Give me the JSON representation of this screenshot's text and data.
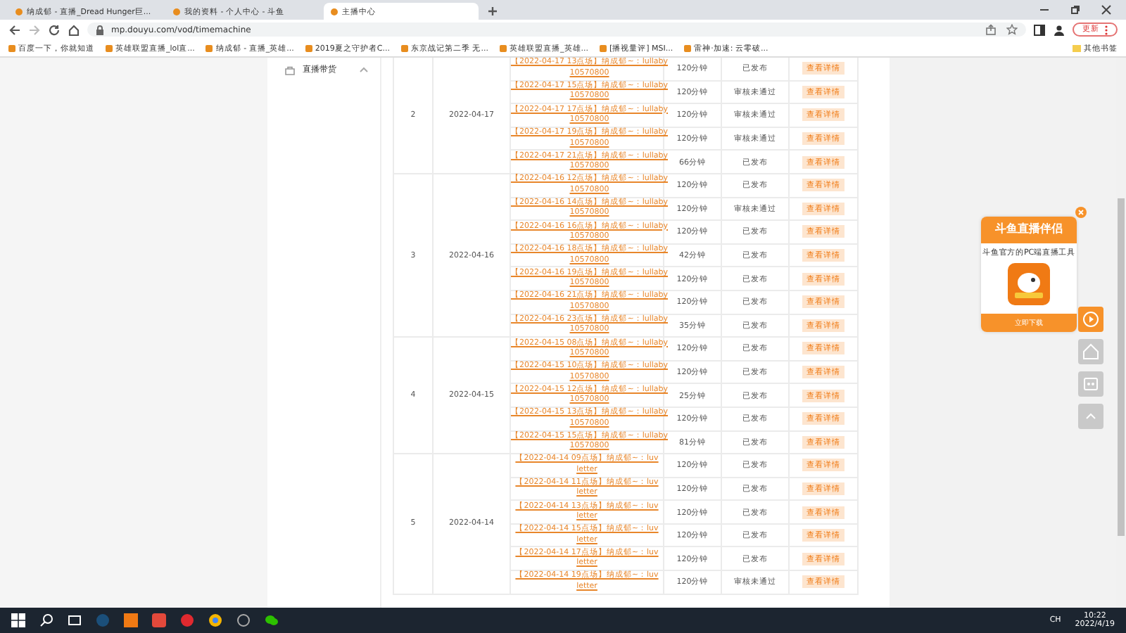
{
  "tabs": [
    {
      "title": "纳成郁 - 直播_Dread Hunger巨...",
      "selected": false
    },
    {
      "title": "我的资料 - 个人中心 - 斗鱼",
      "selected": false
    },
    {
      "title": "主播中心",
      "selected": true
    }
  ],
  "address": "mp.douyu.com/vod/timemachine",
  "update_button": "更新",
  "bookmarks": [
    "百度一下，你就知道",
    "英雄联盟直播_lol直...",
    "纳成郁 - 直播_英雄...",
    "2019夏之守护者C...",
    "东京战记第二季 无...",
    "英雄联盟直播_英雄...",
    "[播视量评] MSI...",
    "雷神·加速: 云零破..."
  ],
  "other_bookmarks": "其他书签",
  "sidebar": {
    "item": "直播带货",
    "expanded": true
  },
  "groups": [
    {
      "index": "2",
      "date": "2022-04-17",
      "rows": [
        {
          "title": [
            "【2022-04-17 13点场】纳成郁~：lullaby",
            "10570800"
          ],
          "duration": "120分钟",
          "status": "已发布",
          "action": "查看详情"
        },
        {
          "title": [
            "【2022-04-17 15点场】纳成郁~：lullaby",
            "10570800"
          ],
          "duration": "120分钟",
          "status": "审核未通过",
          "action": "查看详情"
        },
        {
          "title": [
            "【2022-04-17 17点场】纳成郁~：lullaby",
            "10570800"
          ],
          "duration": "120分钟",
          "status": "审核未通过",
          "action": "查看详情"
        },
        {
          "title": [
            "【2022-04-17 19点场】纳成郁~：lullaby",
            "10570800"
          ],
          "duration": "120分钟",
          "status": "审核未通过",
          "action": "查看详情"
        },
        {
          "title": [
            "【2022-04-17 21点场】纳成郁~：lullaby",
            "10570800"
          ],
          "duration": "66分钟",
          "status": "已发布",
          "action": "查看详情"
        }
      ]
    },
    {
      "index": "3",
      "date": "2022-04-16",
      "rows": [
        {
          "title": [
            "【2022-04-16 12点场】纳成郁~：lullaby",
            "10570800"
          ],
          "duration": "120分钟",
          "status": "已发布",
          "action": "查看详情"
        },
        {
          "title": [
            "【2022-04-16 14点场】纳成郁~：lullaby",
            "10570800"
          ],
          "duration": "120分钟",
          "status": "审核未通过",
          "action": "查看详情"
        },
        {
          "title": [
            "【2022-04-16 16点场】纳成郁~：lullaby",
            "10570800"
          ],
          "duration": "120分钟",
          "status": "已发布",
          "action": "查看详情"
        },
        {
          "title": [
            "【2022-04-16 18点场】纳成郁~：lullaby",
            "10570800"
          ],
          "duration": "42分钟",
          "status": "已发布",
          "action": "查看详情"
        },
        {
          "title": [
            "【2022-04-16 19点场】纳成郁~：lullaby",
            "10570800"
          ],
          "duration": "120分钟",
          "status": "已发布",
          "action": "查看详情"
        },
        {
          "title": [
            "【2022-04-16 21点场】纳成郁~：lullaby",
            "10570800"
          ],
          "duration": "120分钟",
          "status": "已发布",
          "action": "查看详情"
        },
        {
          "title": [
            "【2022-04-16 23点场】纳成郁~：lullaby",
            "10570800"
          ],
          "duration": "35分钟",
          "status": "已发布",
          "action": "查看详情"
        }
      ]
    },
    {
      "index": "4",
      "date": "2022-04-15",
      "rows": [
        {
          "title": [
            "【2022-04-15 08点场】纳成郁~：lullaby",
            "10570800"
          ],
          "duration": "120分钟",
          "status": "已发布",
          "action": "查看详情"
        },
        {
          "title": [
            "【2022-04-15 10点场】纳成郁~：lullaby",
            "10570800"
          ],
          "duration": "120分钟",
          "status": "已发布",
          "action": "查看详情"
        },
        {
          "title": [
            "【2022-04-15 12点场】纳成郁~：lullaby",
            "10570800"
          ],
          "duration": "25分钟",
          "status": "已发布",
          "action": "查看详情"
        },
        {
          "title": [
            "【2022-04-15 13点场】纳成郁~：lullaby",
            "10570800"
          ],
          "duration": "120分钟",
          "status": "已发布",
          "action": "查看详情"
        },
        {
          "title": [
            "【2022-04-15 15点场】纳成郁~：lullaby",
            "10570800"
          ],
          "duration": "81分钟",
          "status": "已发布",
          "action": "查看详情"
        }
      ]
    },
    {
      "index": "5",
      "date": "2022-04-14",
      "rows": [
        {
          "title": [
            "【2022-04-14 09点场】纳成郁~：luv",
            "letter"
          ],
          "duration": "120分钟",
          "status": "已发布",
          "action": "查看详情"
        },
        {
          "title": [
            "【2022-04-14 11点场】纳成郁~：luv",
            "letter"
          ],
          "duration": "120分钟",
          "status": "已发布",
          "action": "查看详情"
        },
        {
          "title": [
            "【2022-04-14 13点场】纳成郁~：luv",
            "letter"
          ],
          "duration": "120分钟",
          "status": "已发布",
          "action": "查看详情"
        },
        {
          "title": [
            "【2022-04-14 15点场】纳成郁~：luv",
            "letter"
          ],
          "duration": "120分钟",
          "status": "已发布",
          "action": "查看详情"
        },
        {
          "title": [
            "【2022-04-14 17点场】纳成郁~：luv",
            "letter"
          ],
          "duration": "120分钟",
          "status": "已发布",
          "action": "查看详情"
        },
        {
          "title": [
            "【2022-04-14 19点场】纳成郁~：luv",
            "letter"
          ],
          "duration": "120分钟",
          "status": "审核未通过",
          "action": "查看详情"
        }
      ]
    }
  ],
  "promo": {
    "title": "斗鱼直播伴侣",
    "subtitle": "斗鱼官方的PC端直播工具",
    "button": "立即下载"
  },
  "taskbar": {
    "lang": "CH",
    "time": "10:22",
    "date": "2022/4/19"
  }
}
